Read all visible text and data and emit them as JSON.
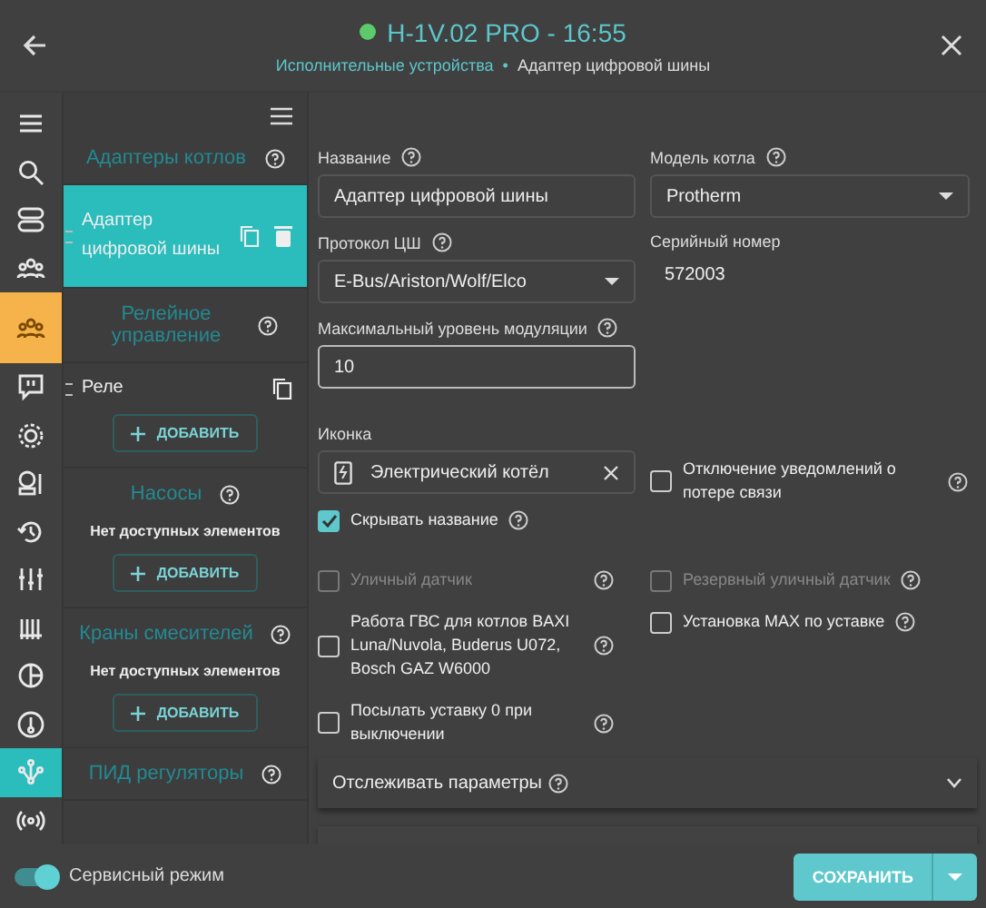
{
  "header": {
    "title": "H-1V.02 PRO - 16:55",
    "breadcrumb": [
      {
        "label": "Исполнительные устройства",
        "kind": "link"
      },
      {
        "label": "•",
        "kind": "separator"
      },
      {
        "label": "Адаптер цифровой шины",
        "kind": "current"
      }
    ]
  },
  "rail": [
    {
      "kind": "menu",
      "selected": false
    },
    {
      "kind": "search",
      "selected": false
    },
    {
      "kind": "module",
      "selected": false
    },
    {
      "kind": "group",
      "selected": false
    },
    {
      "kind": "team",
      "selected": true,
      "color": "#f6b34c"
    },
    {
      "kind": "alert",
      "selected": false
    },
    {
      "kind": "gear",
      "selected": false
    },
    {
      "kind": "sensor",
      "selected": false
    },
    {
      "kind": "history",
      "selected": false
    },
    {
      "kind": "sliders",
      "selected": false
    },
    {
      "kind": "radiator",
      "selected": false
    },
    {
      "kind": "pie",
      "selected": false
    },
    {
      "kind": "thermometer",
      "selected": false
    },
    {
      "kind": "network",
      "selected": true,
      "color": "#2bbcbc"
    },
    {
      "kind": "signal",
      "selected": false
    }
  ],
  "sections": [
    {
      "title": "Адаптеры котлов",
      "items": [
        {
          "label": "Адаптер цифровой шины",
          "selected": true,
          "deletable": true
        }
      ]
    },
    {
      "title": "Релейное управление",
      "items": [
        {
          "label": "Реле",
          "selected": false,
          "deletable": false
        }
      ],
      "add": "ДОБАВИТЬ"
    },
    {
      "title": "Насосы",
      "empty": "Нет доступных элементов",
      "add": "ДОБАВИТЬ"
    },
    {
      "title": "Краны смесителей",
      "empty": "Нет доступных элементов",
      "add": "ДОБАВИТЬ"
    },
    {
      "title": "ПИД регуляторы"
    }
  ],
  "form": {
    "name": {
      "label": "Название",
      "value": "Адаптер цифровой шины"
    },
    "model": {
      "label": "Модель котла",
      "value": "Protherm"
    },
    "protocol": {
      "label": "Протокол ЦШ",
      "value": "E-Bus/Ariston/Wolf/Elco"
    },
    "serial": {
      "label": "Серийный номер",
      "value": "572003"
    },
    "modulation": {
      "label": "Максимальный уровень модуляции",
      "value": "10"
    },
    "icon": {
      "label": "Иконка",
      "value": "Электрический котёл"
    },
    "checks_left": [
      {
        "label": "Скрывать название",
        "checked": true,
        "disabled": false
      }
    ],
    "checks_right": [
      {
        "label": "Отключение уведомлений о потере связи",
        "checked": false,
        "disabled": false
      }
    ],
    "options_left": [
      {
        "label": "Уличный датчик",
        "checked": false,
        "disabled": true
      },
      {
        "label": "Работа ГВС для котлов BAXI Luna/Nuvola, Buderus U072, Bosch GAZ W6000",
        "checked": false,
        "disabled": false
      },
      {
        "label": "Посылать уставку 0 при выключении",
        "checked": false,
        "disabled": false
      }
    ],
    "options_right": [
      {
        "label": "Резервный уличный датчик",
        "checked": false,
        "disabled": true
      },
      {
        "label": "Установка MAX по уставке",
        "checked": false,
        "disabled": false
      }
    ],
    "track": {
      "label": "Отслеживать параметры",
      "expanded": false
    }
  },
  "footer": {
    "service_mode": {
      "label": "Сервисный режим",
      "on": true
    },
    "save": "СОХРАНИТЬ"
  }
}
